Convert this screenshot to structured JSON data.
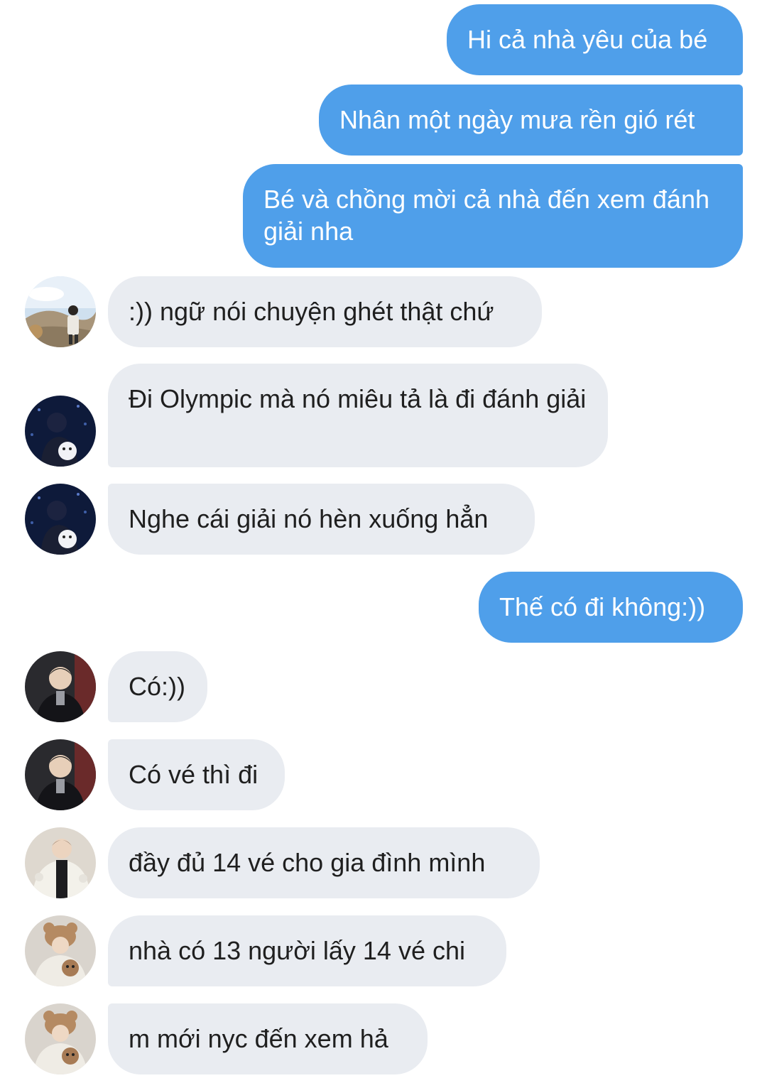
{
  "messages": [
    {
      "id": "m1",
      "direction": "outgoing",
      "text": "Hi cả nhà yêu của bé"
    },
    {
      "id": "m2",
      "direction": "outgoing",
      "text": "Nhân một ngày mưa rền gió rét"
    },
    {
      "id": "m3",
      "direction": "outgoing",
      "text": "Bé và chồng mời cả nhà đến xem đánh giải nha"
    },
    {
      "id": "m4",
      "direction": "incoming",
      "avatar": "landscape-person-avatar",
      "text": ":)) ngữ nói chuyện ghét thật chứ"
    },
    {
      "id": "m5",
      "direction": "incoming",
      "avatar": "night-person-avatar",
      "text": "Đi Olympic mà nó miêu tả là đi đánh giải"
    },
    {
      "id": "m6",
      "direction": "incoming",
      "avatar": "night-person-avatar",
      "text": "Nghe cái giải nó hèn xuống hẳn"
    },
    {
      "id": "m7",
      "direction": "outgoing",
      "text": "Thế có đi không:))"
    },
    {
      "id": "m8",
      "direction": "incoming",
      "avatar": "suit-person-avatar",
      "text": "Có:))"
    },
    {
      "id": "m9",
      "direction": "incoming",
      "avatar": "suit-person-avatar",
      "text": "Có vé thì đi"
    },
    {
      "id": "m10",
      "direction": "incoming",
      "avatar": "fluffy-coat-person-avatar",
      "text": "đầy đủ 14 vé cho gia đình mình"
    },
    {
      "id": "m11",
      "direction": "incoming",
      "avatar": "bear-hat-person-avatar",
      "text": "nhà có 13 người lấy 14 vé chi"
    },
    {
      "id": "m12",
      "direction": "incoming",
      "avatar": "bear-hat-person-avatar",
      "text": "m mới nyc đến xem hả"
    }
  ],
  "colors": {
    "outgoing_bubble": "#4f9fea",
    "incoming_bubble": "#e9ecf1",
    "outgoing_text": "#ffffff",
    "incoming_text": "#1f1f1f"
  }
}
